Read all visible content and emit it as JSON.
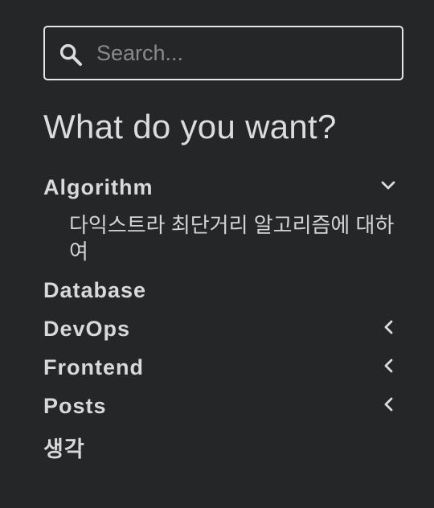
{
  "search": {
    "placeholder": "Search...",
    "value": ""
  },
  "heading": "What do you want?",
  "categories": [
    {
      "label": "Algorithm",
      "chevron": "chevron-down-icon",
      "expanded": true,
      "posts": [
        "다익스트라 최단거리 알고리즘에 대하여"
      ]
    },
    {
      "label": "Database",
      "chevron": null
    },
    {
      "label": "DevOps",
      "chevron": "chevron-left-icon"
    },
    {
      "label": "Frontend",
      "chevron": "chevron-left-icon"
    },
    {
      "label": "Posts",
      "chevron": "chevron-left-icon"
    },
    {
      "label": "생각",
      "chevron": null
    }
  ],
  "colors": {
    "background": "#252627",
    "text": "#d9d9d9",
    "border": "#e6e6e6",
    "placeholder": "#8a8a8a"
  }
}
